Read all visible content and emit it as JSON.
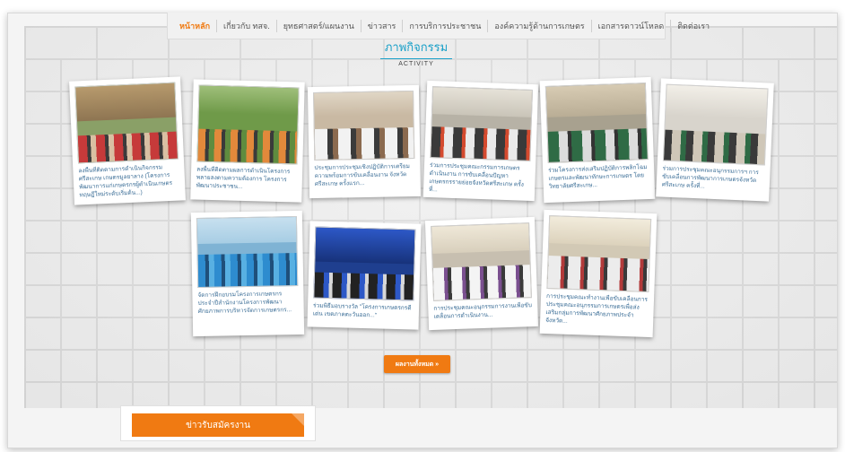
{
  "nav": {
    "items": [
      {
        "label": "หน้าหลัก",
        "active": true
      },
      {
        "label": "เกี่ยวกับ ทสจ.",
        "active": false
      },
      {
        "label": "ยุทธศาสตร์/แผนงาน",
        "active": false
      },
      {
        "label": "ข่าวสาร",
        "active": false
      },
      {
        "label": "การบริการประชาชน",
        "active": false
      },
      {
        "label": "องค์ความรู้ด้านการเกษตร",
        "active": false
      },
      {
        "label": "เอกสารดาวน์โหลด",
        "active": false
      },
      {
        "label": "ติดต่อเรา",
        "active": false
      }
    ]
  },
  "section": {
    "title": "ภาพกิจกรรม",
    "subtitle": "ACTIVITY"
  },
  "activities": [
    {
      "caption": "ลงพื้นที่ติดตามการดำเนินกิจกรรมศรีสะเกษ เกษตรมูลยาลาง (โครงการพัฒนาการแก่เกษตรกรผู้ดำเนินเกษตรทฤษฎีใหม่ระดับเริ่มต้น...)"
    },
    {
      "caption": "ลงพื้นที่ติดตามผลการดำเนินโครงการพลายลงตามความต้องการ โครงการพัฒนาประชาชน..."
    },
    {
      "caption": "ประชุมการประชุมเชิงปฏิบัติการเตรียมความพร้อมการขับเคลื่อนงาน จังหวัดศรีสะเกษ ครั้งแรก..."
    },
    {
      "caption": "ร่วมการประชุมคณะกรรมการเกษตรดำเนินงาน การขับเคลื่อนปัญหาเกษตรกรรายย่อยจังหวัดศรีสะเกษ ครั้งที่..."
    },
    {
      "caption": "ร่วมโครงการส่งเสริมปฏิบัติการพลิกโฉมเกษตรและพัฒนาทักษะการเกษตร โดยวิทยาลัยศรีสะเกษ..."
    },
    {
      "caption": "ร่วมการประชุมคณะอนุกรรมการฯ การขับเคลื่อนการพัฒนาการเกษตรจังหวัดศรีสะเกษ ครั้งที่..."
    },
    {
      "caption": "จัดการฝึกอบรมโครงการเกษตรกรประจำปีสำนักงานโครงการพัฒนาศักยภาพการบริหารจัดการเกษตรกร..."
    },
    {
      "caption": "ร่วมพิธีมอบรางวัล \"โครงการเกษตรกรดีเด่น เขตภาคตะวันออก...\""
    },
    {
      "caption": "การประชุมคณะอนุกรรมการงานเพื่อขับเคลื่อนการดำเนินงาน..."
    },
    {
      "caption": "การประชุมคณะทำงานเพื่อขับเคลื่อนการประชุมคณะอนุกรรมการเกษตรเพื่อส่งเสริมกลุ่มการพัฒนาศักยภาพประจำจังหวัด..."
    }
  ],
  "more_button": {
    "label": "ผลงานทั้งหมด »"
  },
  "bottom": {
    "label": "ข่าวรับสมัครงาน",
    "color": "#f07a12"
  },
  "colors": {
    "accent_orange": "#f07a12",
    "accent_blue": "#1aa0c8",
    "caption_blue": "#3a6d96"
  }
}
